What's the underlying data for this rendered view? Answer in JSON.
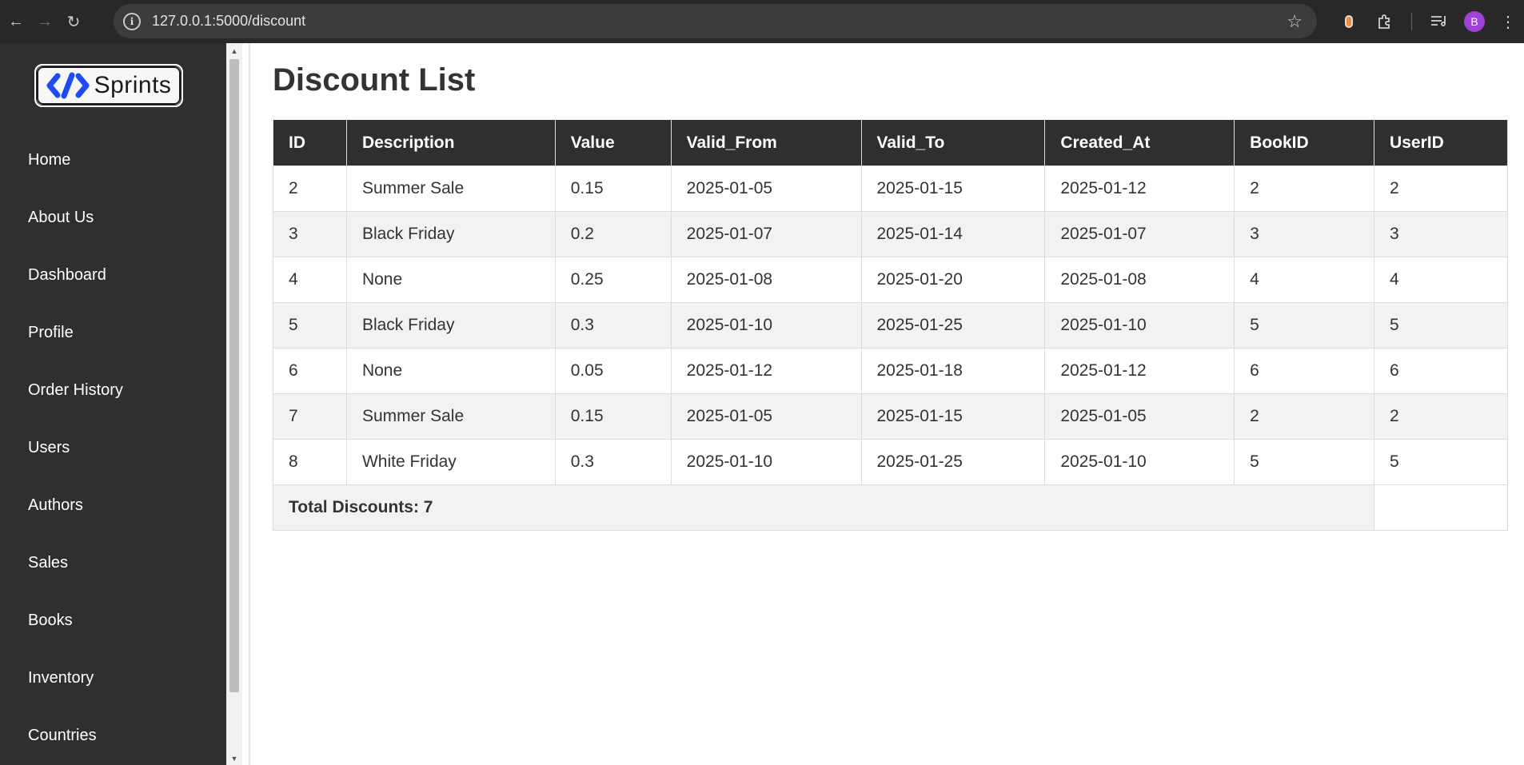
{
  "browser": {
    "url": "127.0.0.1:5000/discount",
    "avatar_letter": "B"
  },
  "sidebar": {
    "logo_text": "Sprints",
    "items": [
      {
        "label": "Home"
      },
      {
        "label": "About Us"
      },
      {
        "label": "Dashboard"
      },
      {
        "label": "Profile"
      },
      {
        "label": "Order History"
      },
      {
        "label": "Users"
      },
      {
        "label": "Authors"
      },
      {
        "label": "Sales"
      },
      {
        "label": "Books"
      },
      {
        "label": "Inventory"
      },
      {
        "label": "Countries"
      }
    ]
  },
  "page": {
    "title": "Discount List",
    "columns": [
      "ID",
      "Description",
      "Value",
      "Valid_From",
      "Valid_To",
      "Created_At",
      "BookID",
      "UserID"
    ],
    "rows": [
      [
        "2",
        "Summer Sale",
        "0.15",
        "2025-01-05",
        "2025-01-15",
        "2025-01-12",
        "2",
        "2"
      ],
      [
        "3",
        "Black Friday",
        "0.2",
        "2025-01-07",
        "2025-01-14",
        "2025-01-07",
        "3",
        "3"
      ],
      [
        "4",
        "None",
        "0.25",
        "2025-01-08",
        "2025-01-20",
        "2025-01-08",
        "4",
        "4"
      ],
      [
        "5",
        "Black Friday",
        "0.3",
        "2025-01-10",
        "2025-01-25",
        "2025-01-10",
        "5",
        "5"
      ],
      [
        "6",
        "None",
        "0.05",
        "2025-01-12",
        "2025-01-18",
        "2025-01-12",
        "6",
        "6"
      ],
      [
        "7",
        "Summer Sale",
        "0.15",
        "2025-01-05",
        "2025-01-15",
        "2025-01-05",
        "2",
        "2"
      ],
      [
        "8",
        "White Friday",
        "0.3",
        "2025-01-10",
        "2025-01-25",
        "2025-01-10",
        "5",
        "5"
      ]
    ],
    "total_label": "Total Discounts: 7"
  },
  "colors": {
    "sidebar_bg": "#2f2f2f",
    "header_bg": "#2f2f2f",
    "stripe": "#f2f2f2",
    "logo_accent": "#1f4cf0",
    "avatar": "#a142d6"
  }
}
